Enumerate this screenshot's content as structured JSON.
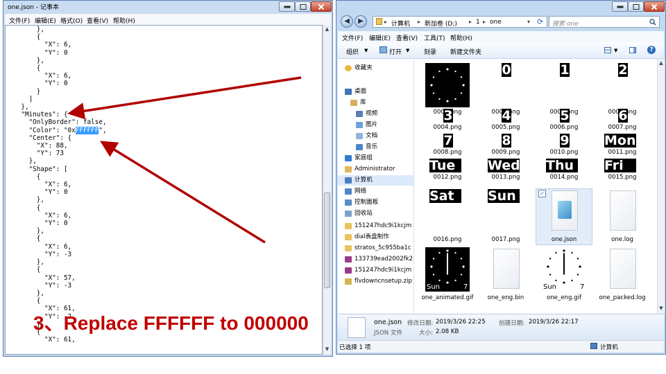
{
  "notepad": {
    "title": "one.json - 记事本",
    "menu": [
      "文件(F)",
      "编辑(E)",
      "格式(O)",
      "查看(V)",
      "帮助(H)"
    ],
    "code_before": "        },\n        {\n          \"X\": 6,\n          \"Y\": 0\n        },\n        {\n          \"X\": 6,\n          \"Y\": 0\n        }\n      ]\n    },\n    \"Minutes\": {\n      \"OnlyBorder\": false,\n      \"Color\": \"0x",
    "code_selected": "FFFFFF",
    "code_after": "\",\n      \"Center\": {\n        \"X\": 88,\n        \"Y\": 73\n      },\n      \"Shape\": [\n        {\n          \"X\": 6,\n          \"Y\": 0\n        },\n        {\n          \"X\": 6,\n          \"Y\": 0\n        },\n        {\n          \"X\": 6,\n          \"Y\": -3\n        },\n        {\n          \"X\": 57,\n          \"Y\": -3\n        },\n        {\n          \"X\": 61,\n          \"Y\": -2\n        },\n        {\n          \"X\": 61,"
  },
  "explorer": {
    "breadcrumb": [
      "计算机",
      "新加卷 (D:)",
      "1",
      "one"
    ],
    "search_placeholder": "搜索 one",
    "menu": [
      "文件(F)",
      "编辑(E)",
      "查看(V)",
      "工具(T)",
      "帮助(H)"
    ],
    "toolbar": [
      "组织",
      "打开",
      "刻录",
      "新建文件夹"
    ],
    "nav": [
      {
        "label": "收藏夹",
        "icon": "star-icon"
      },
      {
        "label": "桌面",
        "icon": "desktop-icon"
      },
      {
        "label": "库",
        "icon": "library-icon"
      },
      {
        "label": "视频",
        "icon": "video-icon"
      },
      {
        "label": "图片",
        "icon": "picture-icon"
      },
      {
        "label": "文档",
        "icon": "document-icon"
      },
      {
        "label": "音乐",
        "icon": "music-icon"
      },
      {
        "label": "家庭组",
        "icon": "homegroup-icon"
      },
      {
        "label": "Administrator",
        "icon": "user-icon"
      },
      {
        "label": "计算机",
        "icon": "computer-icon"
      },
      {
        "label": "网络",
        "icon": "network-icon"
      },
      {
        "label": "控制面板",
        "icon": "control-panel-icon"
      },
      {
        "label": "回收站",
        "icon": "recycle-bin-icon"
      },
      {
        "label": "151247hdc9i1kcjm",
        "icon": "folder-icon"
      },
      {
        "label": "dial表盘制作",
        "icon": "folder-icon"
      },
      {
        "label": "stratos_5c955ba1c",
        "icon": "folder-icon"
      },
      {
        "label": "133739ead2002fk2",
        "icon": "archive-icon"
      },
      {
        "label": "151247hdc9i1kcjm",
        "icon": "archive-icon"
      },
      {
        "label": "flvdowncnsetup.zip",
        "icon": "zip-icon"
      }
    ],
    "files": [
      {
        "name": "0000.png",
        "kind": "dial"
      },
      {
        "name": "0001.png",
        "kind": "text",
        "text": "0"
      },
      {
        "name": "0002.png",
        "kind": "text",
        "text": "1"
      },
      {
        "name": "0003.png",
        "kind": "text",
        "text": "2"
      },
      {
        "name": "0004.png",
        "kind": "text",
        "text": "3"
      },
      {
        "name": "0005.png",
        "kind": "text",
        "text": "4"
      },
      {
        "name": "0006.png",
        "kind": "text",
        "text": "5"
      },
      {
        "name": "0007.png",
        "kind": "text",
        "text": "6"
      },
      {
        "name": "0008.png",
        "kind": "text",
        "text": "7"
      },
      {
        "name": "0009.png",
        "kind": "text",
        "text": "8"
      },
      {
        "name": "0010.png",
        "kind": "text",
        "text": "9"
      },
      {
        "name": "0011.png",
        "kind": "text",
        "text": "Mon"
      },
      {
        "name": "0012.png",
        "kind": "text",
        "text": "Tue"
      },
      {
        "name": "0013.png",
        "kind": "text",
        "text": "Wed"
      },
      {
        "name": "0014.png",
        "kind": "text",
        "text": "Thu"
      },
      {
        "name": "0015.png",
        "kind": "text",
        "text": "Fri"
      },
      {
        "name": "0016.png",
        "kind": "text",
        "text": "Sat"
      },
      {
        "name": "0017.png",
        "kind": "text",
        "text": "Sun"
      },
      {
        "name": "one.json",
        "kind": "json"
      },
      {
        "name": "one.log",
        "kind": "doc"
      },
      {
        "name": "one_animated.gif",
        "kind": "animated",
        "day": "Sun",
        "num": "7"
      },
      {
        "name": "one_eng.bin",
        "kind": "doc"
      },
      {
        "name": "one_eng.gif",
        "kind": "clock",
        "day": "Sun",
        "num": "7"
      },
      {
        "name": "one_packed.log",
        "kind": "doc"
      }
    ],
    "details": {
      "name": "one.json",
      "modified_label": "修改日期:",
      "modified": "2019/3/26 22:25",
      "created_label": "创建日期:",
      "created": "2019/3/26 22:17",
      "type": "JSON 文件",
      "size_label": "大小:",
      "size": "2.08 KB"
    },
    "status_left": "已选择 1 项",
    "status_right": "计算机"
  },
  "annotation": {
    "caption": "3、Replace FFFFFF  to  000000",
    "arrow_color": "#b00000"
  }
}
